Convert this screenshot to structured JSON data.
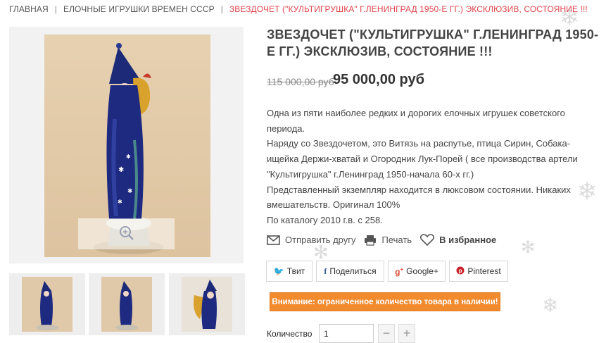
{
  "breadcrumb": {
    "items": [
      "ГЛАВНАЯ",
      "ЕЛОЧНЫЕ ИГРУШКИ ВРЕМЕН СССР"
    ],
    "separator": "|",
    "current": "ЗВЕЗДОЧЕТ (\"КУЛЬТИГРУШКА\" Г.ЛЕНИНГРАД 1950-Е ГГ.) ЭКСКЛЮЗИВ, СОСТОЯНИЕ !!!"
  },
  "product": {
    "title": "ЗВЕЗДОЧЕТ (\"КУЛЬТИГРУШКА\" Г.ЛЕНИНГРАД 1950-Е ГГ.) ЭКСКЛЮЗИВ, СОСТОЯНИЕ !!!",
    "price_old": "115 000,00 руб",
    "price_new": "95 000,00 руб",
    "description": [
      "Одна из пяти наиболее редких и дорогих елочных игрушек советского периода.",
      "Наряду со Звездочетом, это Витязь на распутье, птица Сирин, Собака-ищейка Держи-хватай и Огородник Лук-Порей ( все производства артели \"Культигрушка\"  г.Ленинград 1950-начала 60-х гг.)",
      "Представленный экземпляр находится в люксовом состоянии. Никаких вмешательств. Оригинал 100%",
      "По каталогу 2010 г.в. с 258."
    ]
  },
  "actions": {
    "send": "Отправить другу",
    "print": "Печать",
    "favorite": "В избранное"
  },
  "share": {
    "twitter": "Твит",
    "facebook": "Поделиться",
    "google": "Google+",
    "pinterest": "Pinterest"
  },
  "warning": "Внимание: ограниченное количество товара в наличии!",
  "quantity": {
    "label": "Количество",
    "value": "1",
    "minus": "−",
    "plus": "+"
  },
  "colors": {
    "accent_red": "#e0464f",
    "warning_orange": "#f28a2e",
    "twitter": "#55acee",
    "facebook": "#3b5998",
    "google": "#dd4b39",
    "pinterest": "#cb2027"
  }
}
